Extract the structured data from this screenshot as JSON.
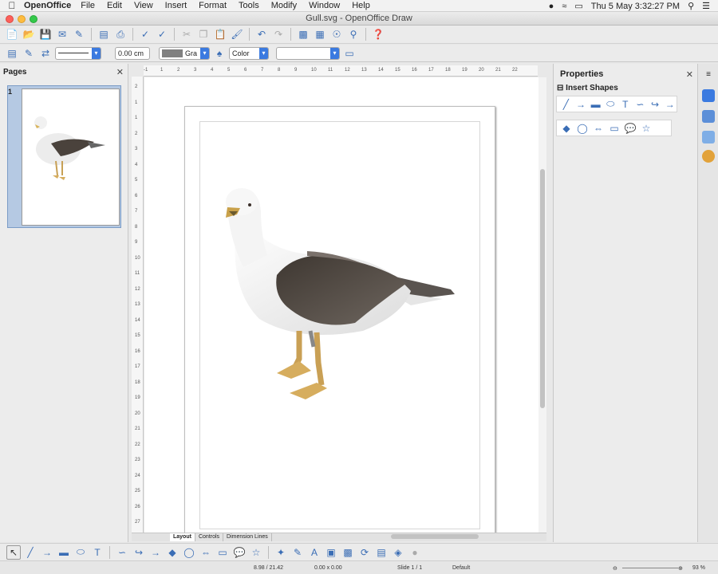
{
  "menubar": {
    "app_name": "OpenOffice",
    "items": [
      "File",
      "Edit",
      "View",
      "Insert",
      "Format",
      "Tools",
      "Modify",
      "Window",
      "Help"
    ],
    "clock": "Thu 5 May  3:32:27 PM"
  },
  "window": {
    "title": "Gull.svg - OpenOffice Draw"
  },
  "line_props": {
    "width_value": "0.00 cm",
    "fill_color_label": "Gra",
    "area_style": "Color"
  },
  "pages_panel": {
    "title": "Pages",
    "page_number": "1"
  },
  "ruler": {
    "h_ticks": [
      "-1",
      "1",
      "2",
      "3",
      "4",
      "5",
      "6",
      "7",
      "8",
      "9",
      "10",
      "11",
      "12",
      "13",
      "14",
      "15",
      "16",
      "17",
      "18",
      "19",
      "20",
      "21",
      "22"
    ],
    "v_ticks": [
      "2",
      "1",
      "1",
      "2",
      "3",
      "4",
      "5",
      "6",
      "7",
      "8",
      "9",
      "10",
      "11",
      "12",
      "13",
      "14",
      "15",
      "16",
      "17",
      "18",
      "19",
      "20",
      "21",
      "22",
      "23",
      "24",
      "25",
      "26",
      "27"
    ]
  },
  "tabs": [
    "Layout",
    "Controls",
    "Dimension Lines"
  ],
  "properties": {
    "title": "Properties",
    "section": "Insert Shapes"
  },
  "status": {
    "position": "8.98 / 21.42",
    "size": "0.00 x 0.00",
    "slide": "Slide 1 / 1",
    "layout": "Default",
    "zoom": "93 %"
  },
  "colors": {
    "accent": "#3b7ae0",
    "selection": "#b5c9e3",
    "wing_dark": "#4a423c"
  }
}
